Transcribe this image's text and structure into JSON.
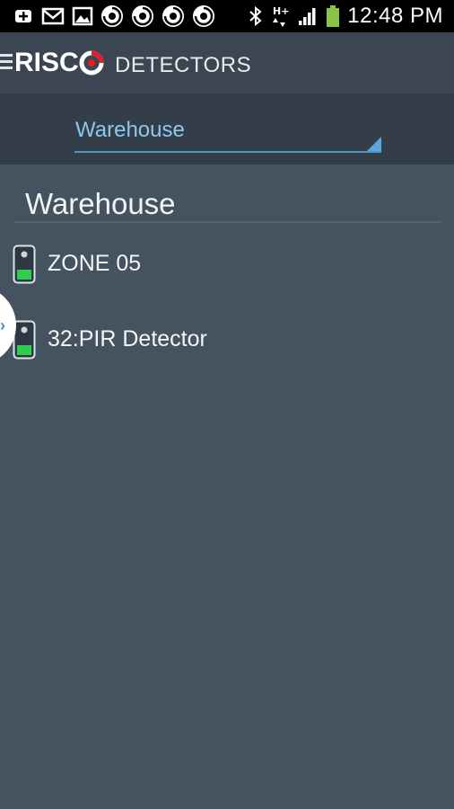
{
  "status_bar": {
    "time": "12:48 PM",
    "left_icons": [
      "add-notification-icon",
      "mail-icon",
      "gallery-icon",
      "risco-app-icon",
      "risco-app-icon",
      "risco-app-icon",
      "risco-app-icon"
    ],
    "right_icons": [
      "bluetooth-icon",
      "hspa-data-icon",
      "signal-icon",
      "battery-icon"
    ],
    "battery_color": "#8bc34a"
  },
  "app_bar": {
    "logo_text": "RISC",
    "title": "DETECTORS",
    "brand_color": "#e31f26"
  },
  "selector": {
    "value": "Warehouse",
    "accent": "#5aa6da"
  },
  "section": {
    "title": "Warehouse"
  },
  "detectors": [
    {
      "label": "ZONE 05",
      "status_color": "#2ecc4f"
    },
    {
      "label": "32:PIR Detector",
      "status_color": "#2ecc4f"
    }
  ]
}
